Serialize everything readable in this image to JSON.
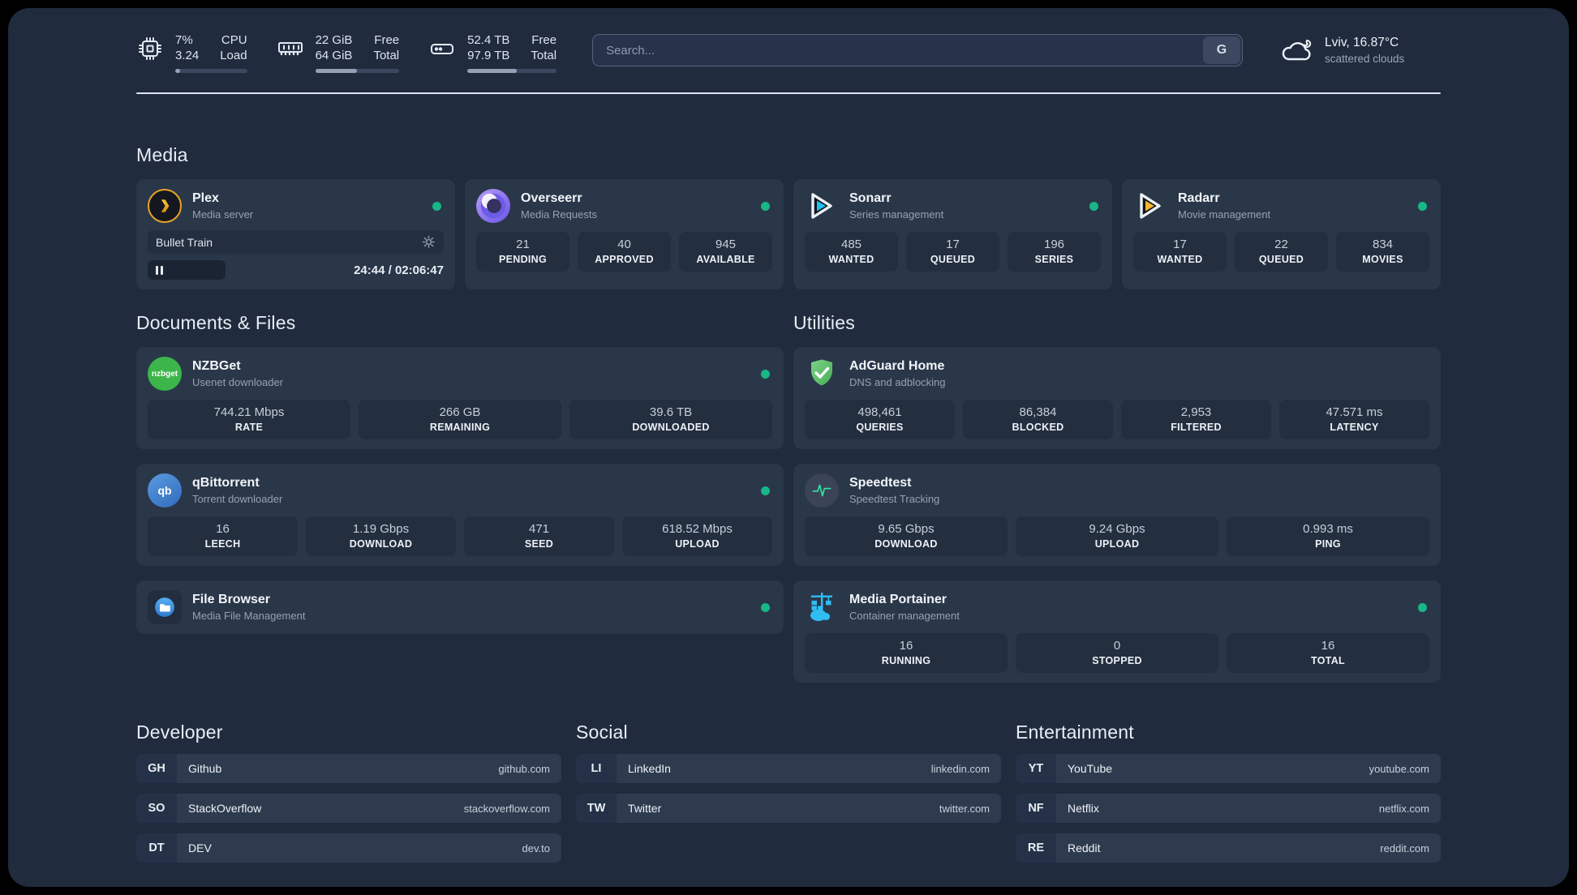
{
  "colors": {
    "status_online": "#17b787",
    "plex_gold": "#e8a326",
    "sonarr_cyan": "#1ec1f3",
    "radarr_amber": "#f7b42c",
    "overseerr_purple": "#7c5ff0",
    "nzbget_green": "#3cb54a",
    "qbittorrent_blue": "#3f7fd1",
    "adguard_green": "#5fc46a",
    "speedtest_green": "#2ee6a0",
    "portainer_blue": "#2fbdf2"
  },
  "header": {
    "system": [
      {
        "icon": "cpu-icon",
        "v1": "7%",
        "v2": "3.24",
        "l1": "CPU",
        "l2": "Load",
        "progress": 7
      },
      {
        "icon": "ram-icon",
        "v1": "22 GiB",
        "v2": "64 GiB",
        "l1": "Free",
        "l2": "Total",
        "progress": 50
      },
      {
        "icon": "disk-icon",
        "v1": "52.4 TB",
        "v2": "97.9 TB",
        "l1": "Free",
        "l2": "Total",
        "progress": 55
      }
    ],
    "search": {
      "placeholder": "Search...",
      "button": "G"
    },
    "weather": {
      "icon": "cloud-icon",
      "location": "Lviv, 16.87°C",
      "condition": "scattered clouds"
    }
  },
  "media": {
    "title": "Media",
    "plex": {
      "icon": "plex-icon",
      "name": "Plex",
      "desc": "Media server",
      "player": {
        "title": "Bullet Train",
        "time": "24:44 / 02:06:47"
      }
    },
    "overseerr": {
      "icon": "overseerr-icon",
      "name": "Overseerr",
      "desc": "Media Requests",
      "stats": [
        {
          "value": "21",
          "label": "PENDING"
        },
        {
          "value": "40",
          "label": "APPROVED"
        },
        {
          "value": "945",
          "label": "AVAILABLE"
        }
      ]
    },
    "sonarr": {
      "icon": "sonarr-icon",
      "name": "Sonarr",
      "desc": "Series management",
      "stats": [
        {
          "value": "485",
          "label": "WANTED"
        },
        {
          "value": "17",
          "label": "QUEUED"
        },
        {
          "value": "196",
          "label": "SERIES"
        }
      ]
    },
    "radarr": {
      "icon": "radarr-icon",
      "name": "Radarr",
      "desc": "Movie management",
      "stats": [
        {
          "value": "17",
          "label": "WANTED"
        },
        {
          "value": "22",
          "label": "QUEUED"
        },
        {
          "value": "834",
          "label": "MOVIES"
        }
      ]
    }
  },
  "documents": {
    "title": "Documents & Files",
    "nzbget": {
      "icon": "nzbget-icon",
      "abbr": "nzbget",
      "name": "NZBGet",
      "desc": "Usenet downloader",
      "stats": [
        {
          "value": "744.21 Mbps",
          "label": "RATE"
        },
        {
          "value": "266 GB",
          "label": "REMAINING"
        },
        {
          "value": "39.6 TB",
          "label": "DOWNLOADED"
        }
      ]
    },
    "qbittorrent": {
      "icon": "qbittorrent-icon",
      "abbr": "qb",
      "name": "qBittorrent",
      "desc": "Torrent downloader",
      "stats": [
        {
          "value": "16",
          "label": "LEECH"
        },
        {
          "value": "1.19 Gbps",
          "label": "DOWNLOAD"
        },
        {
          "value": "471",
          "label": "SEED"
        },
        {
          "value": "618.52 Mbps",
          "label": "UPLOAD"
        }
      ]
    },
    "filebrowser": {
      "icon": "filebrowser-icon",
      "name": "File Browser",
      "desc": "Media File Management"
    }
  },
  "utilities": {
    "title": "Utilities",
    "adguard": {
      "icon": "adguard-icon",
      "name": "AdGuard Home",
      "desc": "DNS and adblocking",
      "stats": [
        {
          "value": "498,461",
          "label": "QUERIES"
        },
        {
          "value": "86,384",
          "label": "BLOCKED"
        },
        {
          "value": "2,953",
          "label": "FILTERED"
        },
        {
          "value": "47.571 ms",
          "label": "LATENCY"
        }
      ]
    },
    "speedtest": {
      "icon": "speedtest-icon",
      "name": "Speedtest",
      "desc": "Speedtest Tracking",
      "stats": [
        {
          "value": "9.65 Gbps",
          "label": "DOWNLOAD"
        },
        {
          "value": "9.24 Gbps",
          "label": "UPLOAD"
        },
        {
          "value": "0.993 ms",
          "label": "PING"
        }
      ]
    },
    "portainer": {
      "icon": "portainer-icon",
      "name": "Media Portainer",
      "desc": "Container management",
      "stats": [
        {
          "value": "16",
          "label": "RUNNING"
        },
        {
          "value": "0",
          "label": "STOPPED"
        },
        {
          "value": "16",
          "label": "TOTAL"
        }
      ]
    }
  },
  "links": {
    "developer": {
      "title": "Developer",
      "items": [
        {
          "abbr": "GH",
          "name": "Github",
          "url": "github.com"
        },
        {
          "abbr": "SO",
          "name": "StackOverflow",
          "url": "stackoverflow.com"
        },
        {
          "abbr": "DT",
          "name": "DEV",
          "url": "dev.to"
        }
      ]
    },
    "social": {
      "title": "Social",
      "items": [
        {
          "abbr": "LI",
          "name": "LinkedIn",
          "url": "linkedin.com"
        },
        {
          "abbr": "TW",
          "name": "Twitter",
          "url": "twitter.com"
        }
      ]
    },
    "entertainment": {
      "title": "Entertainment",
      "items": [
        {
          "abbr": "YT",
          "name": "YouTube",
          "url": "youtube.com"
        },
        {
          "abbr": "NF",
          "name": "Netflix",
          "url": "netflix.com"
        },
        {
          "abbr": "RE",
          "name": "Reddit",
          "url": "reddit.com"
        }
      ]
    }
  }
}
